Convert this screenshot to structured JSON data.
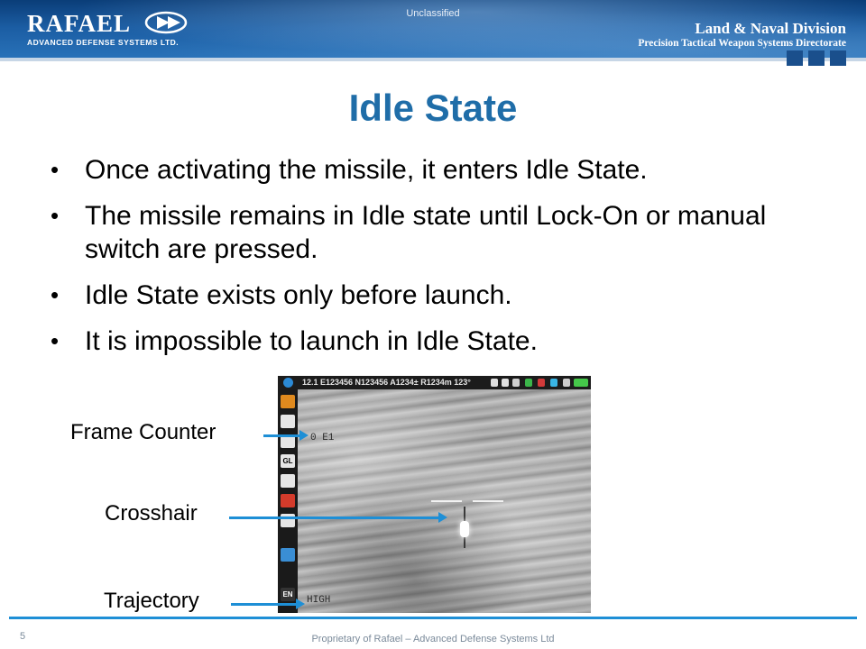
{
  "header": {
    "classification": "Unclassified",
    "logo_word": "RAFAEL",
    "logo_subtitle": "ADVANCED DEFENSE SYSTEMS LTD.",
    "division": "Land & Naval Division",
    "directorate": "Precision Tactical Weapon Systems Directorate"
  },
  "slide": {
    "title": "Idle State",
    "bullets": [
      "Once activating the missile, it enters Idle State.",
      "The missile remains in Idle state until Lock-On or manual switch are pressed.",
      "Idle State exists only before launch.",
      "It is impossible to launch in Idle State."
    ]
  },
  "video": {
    "hud_readout": "12.1  E123456  N123456  A1234±  R1234m  123°",
    "frame_counter_value": "0 E1",
    "trajectory_value": "HIGH",
    "side_language": "EN"
  },
  "callouts": {
    "frame_counter": "Frame Counter",
    "crosshair": "Crosshair",
    "trajectory": "Trajectory"
  },
  "footer": {
    "page_number": "5",
    "proprietary": "Proprietary of Rafael – Advanced Defense Systems Ltd"
  },
  "colors": {
    "title": "#1f6da8",
    "accent_line": "#1e8fd6",
    "banner": "#1b5da3"
  }
}
